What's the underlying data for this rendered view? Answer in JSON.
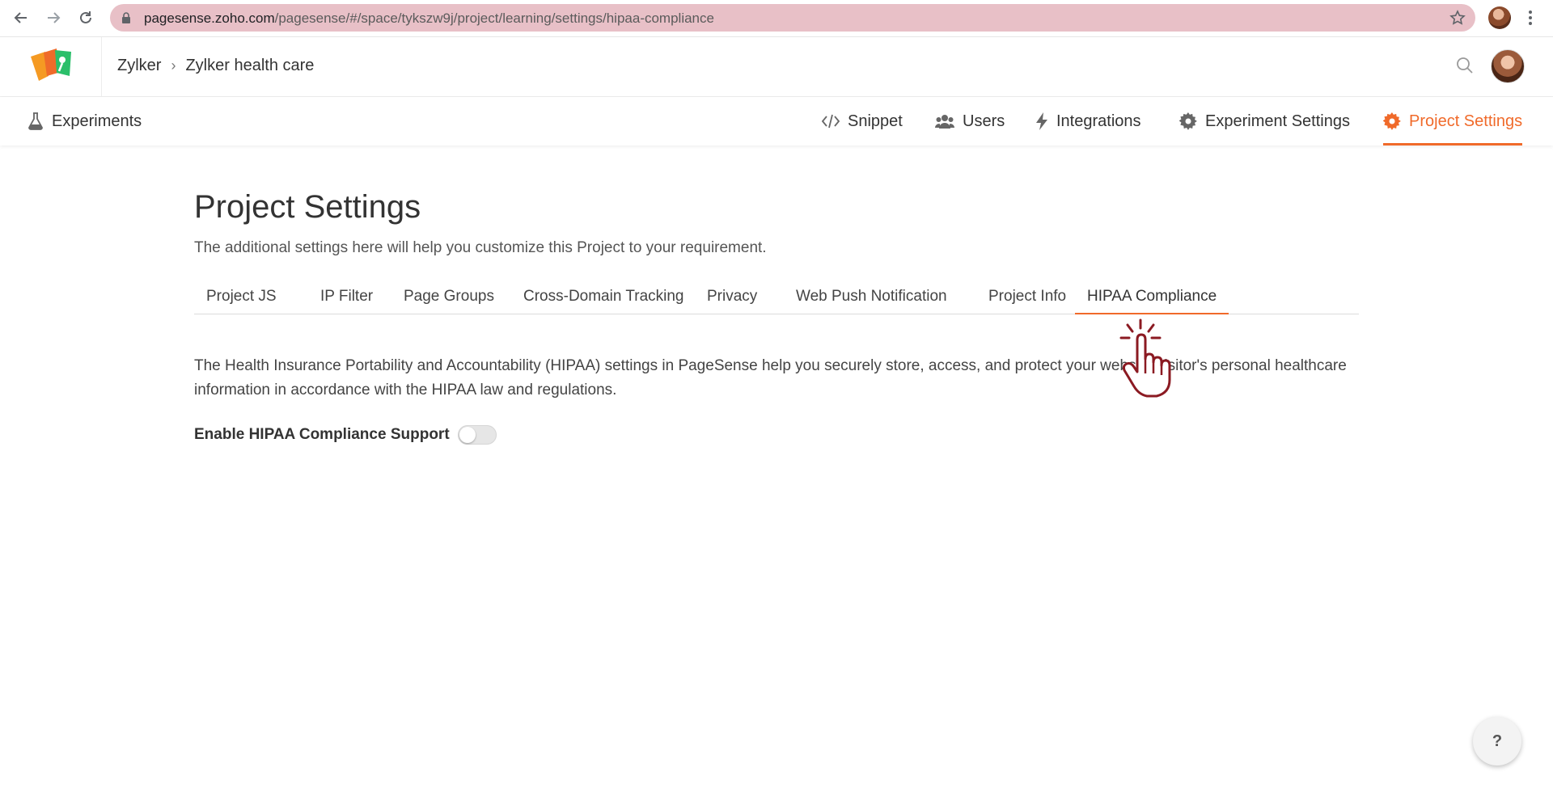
{
  "browser": {
    "url_host": "pagesense.zoho.com",
    "url_path": "/pagesense/#/space/tykszw9j/project/learning/settings/hipaa-compliance"
  },
  "header": {
    "breadcrumb": [
      "Zylker",
      "Zylker health care"
    ],
    "breadcrumb_separator": "›"
  },
  "subnav": {
    "left": {
      "label": "Experiments",
      "icon": "flask-icon"
    },
    "right": [
      {
        "label": "Snippet",
        "icon": "code-icon"
      },
      {
        "label": "Users",
        "icon": "users-icon"
      },
      {
        "label": "Integrations",
        "icon": "lightning-icon"
      },
      {
        "label": "Experiment Settings",
        "icon": "gear-icon"
      },
      {
        "label": "Project Settings",
        "icon": "gear-icon",
        "active": true
      }
    ]
  },
  "page": {
    "title": "Project Settings",
    "subtitle": "The additional settings here will help you customize this Project to your requirement.",
    "tabs": [
      {
        "label": "Project JS"
      },
      {
        "label": "IP Filter"
      },
      {
        "label": "Page Groups"
      },
      {
        "label": "Cross-Domain Tracking"
      },
      {
        "label": "Privacy"
      },
      {
        "label": "Web Push Notification"
      },
      {
        "label": "Project Info"
      },
      {
        "label": "HIPAA Compliance",
        "active": true
      }
    ],
    "description": "The Health Insurance Portability and Accountability (HIPAA) settings in PageSense help you securely store, access, and protect your website visitor's personal healthcare information in accordance with the HIPAA law and regulations.",
    "toggle": {
      "label": "Enable HIPAA Compliance Support",
      "enabled": false
    }
  },
  "help": {
    "label": "?"
  },
  "colors": {
    "accent": "#f06a2a",
    "omnibox": "#e8c0c7"
  }
}
